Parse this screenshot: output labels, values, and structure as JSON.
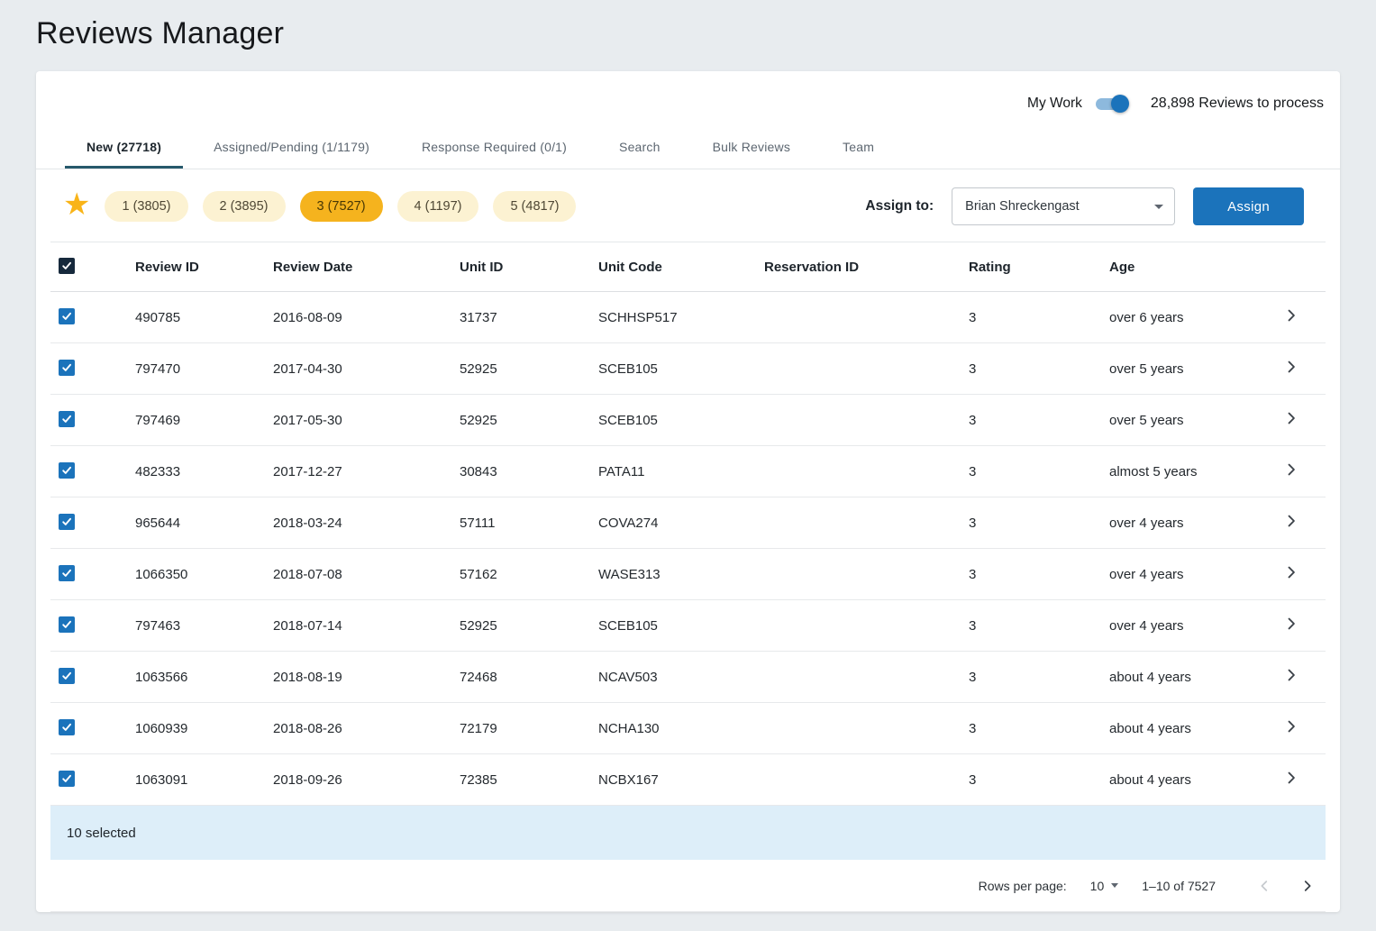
{
  "colors": {
    "page-bg": "#e8ecef",
    "card-bg": "#ffffff",
    "primary-blue": "#1b73bb",
    "header-checkbox": "#16293c",
    "tab-underline": "#26596b",
    "chip-bg": "#fcf2d2",
    "chip-selected-bg": "#f5b31e",
    "star-gold": "#f9b418",
    "selection-bar-bg": "#ddeef9"
  },
  "page": {
    "title": "Reviews Manager"
  },
  "topbar": {
    "my_work_label": "My Work",
    "toggle_on": true,
    "reviews_count_label": "28,898 Reviews to process"
  },
  "tabs": [
    {
      "id": "new",
      "label": "New (27718)",
      "active": true
    },
    {
      "id": "assigned-pending",
      "label": "Assigned/Pending (1/1179)",
      "active": false
    },
    {
      "id": "response-required",
      "label": "Response Required (0/1)",
      "active": false
    },
    {
      "id": "search",
      "label": "Search",
      "active": false
    },
    {
      "id": "bulk-reviews",
      "label": "Bulk Reviews",
      "active": false
    },
    {
      "id": "team",
      "label": "Team",
      "active": false
    }
  ],
  "rating_filters": {
    "chips": [
      {
        "label": "1 (3805)",
        "selected": false
      },
      {
        "label": "2 (3895)",
        "selected": false
      },
      {
        "label": "3 (7527)",
        "selected": true
      },
      {
        "label": "4 (1197)",
        "selected": false
      },
      {
        "label": "5 (4817)",
        "selected": false
      }
    ]
  },
  "assign": {
    "label": "Assign to:",
    "selected_user": "Brian Shreckengast",
    "button_label": "Assign"
  },
  "table": {
    "columns": [
      "Review ID",
      "Review Date",
      "Unit ID",
      "Unit Code",
      "Reservation ID",
      "Rating",
      "Age"
    ],
    "header_checkbox_checked": true,
    "rows": [
      {
        "checked": true,
        "review_id": "490785",
        "review_date": "2016-08-09",
        "unit_id": "31737",
        "unit_code": "SCHHSP517",
        "reservation_id": "",
        "rating": "3",
        "age": "over 6 years"
      },
      {
        "checked": true,
        "review_id": "797470",
        "review_date": "2017-04-30",
        "unit_id": "52925",
        "unit_code": "SCEB105",
        "reservation_id": "",
        "rating": "3",
        "age": "over 5 years"
      },
      {
        "checked": true,
        "review_id": "797469",
        "review_date": "2017-05-30",
        "unit_id": "52925",
        "unit_code": "SCEB105",
        "reservation_id": "",
        "rating": "3",
        "age": "over 5 years"
      },
      {
        "checked": true,
        "review_id": "482333",
        "review_date": "2017-12-27",
        "unit_id": "30843",
        "unit_code": "PATA11",
        "reservation_id": "",
        "rating": "3",
        "age": "almost 5 years"
      },
      {
        "checked": true,
        "review_id": "965644",
        "review_date": "2018-03-24",
        "unit_id": "57111",
        "unit_code": "COVA274",
        "reservation_id": "",
        "rating": "3",
        "age": "over 4 years"
      },
      {
        "checked": true,
        "review_id": "1066350",
        "review_date": "2018-07-08",
        "unit_id": "57162",
        "unit_code": "WASE313",
        "reservation_id": "",
        "rating": "3",
        "age": "over 4 years"
      },
      {
        "checked": true,
        "review_id": "797463",
        "review_date": "2018-07-14",
        "unit_id": "52925",
        "unit_code": "SCEB105",
        "reservation_id": "",
        "rating": "3",
        "age": "over 4 years"
      },
      {
        "checked": true,
        "review_id": "1063566",
        "review_date": "2018-08-19",
        "unit_id": "72468",
        "unit_code": "NCAV503",
        "reservation_id": "",
        "rating": "3",
        "age": "about 4 years"
      },
      {
        "checked": true,
        "review_id": "1060939",
        "review_date": "2018-08-26",
        "unit_id": "72179",
        "unit_code": "NCHA130",
        "reservation_id": "",
        "rating": "3",
        "age": "about 4 years"
      },
      {
        "checked": true,
        "review_id": "1063091",
        "review_date": "2018-09-26",
        "unit_id": "72385",
        "unit_code": "NCBX167",
        "reservation_id": "",
        "rating": "3",
        "age": "about 4 years"
      }
    ],
    "selection_summary": "10 selected"
  },
  "pagination": {
    "rows_per_page_label": "Rows per page:",
    "rows_per_page_value": "10",
    "range_label": "1–10 of 7527"
  }
}
